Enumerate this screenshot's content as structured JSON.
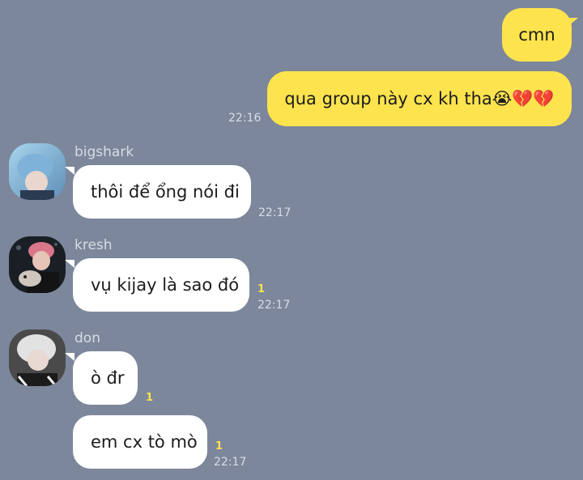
{
  "messages": {
    "m1": {
      "text": "cmn"
    },
    "m2": {
      "text": "qua group này cx kh tha😭💔💔",
      "time": "22:16"
    },
    "m3": {
      "sender": "bigshark",
      "text": "thôi để ổng nói đi",
      "time": "22:17"
    },
    "m4": {
      "sender": "kresh",
      "text": "vụ kijay là sao đó",
      "unread": "1",
      "time": "22:17"
    },
    "m5": {
      "sender": "don",
      "text": "ò đr",
      "unread": "1"
    },
    "m6": {
      "text": "em cx tò mò",
      "unread": "1",
      "time": "22:17"
    }
  },
  "colors": {
    "background": "#7c879b",
    "outgoing_bubble": "#fde34d",
    "incoming_bubble": "#ffffff",
    "unread_count": "#fde34d"
  },
  "avatars": {
    "bigshark": "avatar-bigshark",
    "kresh": "avatar-kresh",
    "don": "avatar-don"
  }
}
